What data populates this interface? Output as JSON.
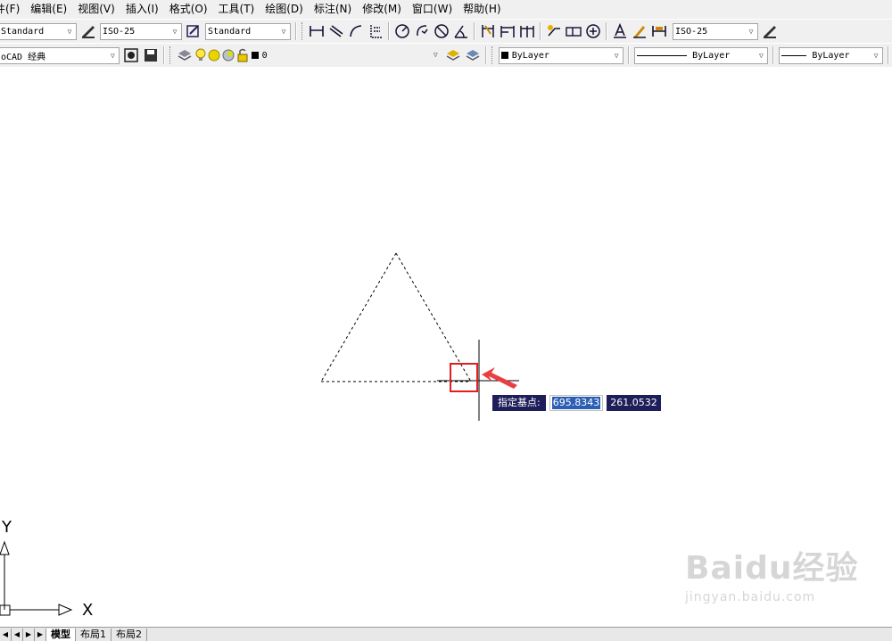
{
  "menubar": {
    "items": [
      "件(F)",
      "编辑(E)",
      "视图(V)",
      "插入(I)",
      "格式(O)",
      "工具(T)",
      "绘图(D)",
      "标注(N)",
      "修改(M)",
      "窗口(W)",
      "帮助(H)"
    ]
  },
  "toolbar1": {
    "text_style": "Standard",
    "dim_style": "ISO-25",
    "table_style": "Standard",
    "dim_style_right": "ISO-25"
  },
  "toolbar2": {
    "workspace": "oCAD 经典",
    "layer": "0",
    "color": "ByLayer",
    "linetype": "ByLayer",
    "lineweight": "ByLayer"
  },
  "prompt": {
    "label": "指定基点:",
    "x_value": "695.8343",
    "y_value": "261.0532"
  },
  "ucs": {
    "y_label": "Y",
    "x_label": "X"
  },
  "tabs": {
    "items": [
      "模型",
      "布局1",
      "布局2"
    ]
  },
  "watermark": {
    "main": "Baidu经验",
    "sub": "jingyan.baidu.com"
  },
  "colors": {
    "highlight_box": "#e02020",
    "arrow": "#e84040",
    "prompt_bg": "#1e1e5a"
  }
}
